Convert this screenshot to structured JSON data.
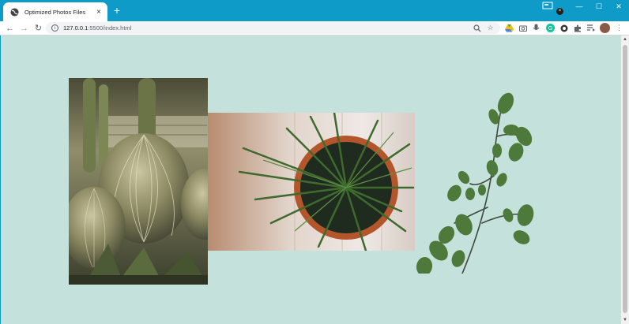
{
  "browser": {
    "tab_title": "Optimized Photos Files",
    "url_host": "127.0.0.1",
    "url_path": ":5500/index.html",
    "new_tab_label": "+",
    "tab_close_label": "×",
    "ext_dot_label": "×"
  },
  "window_controls": {
    "minimize": "—",
    "maximize": "☐",
    "close": "✕"
  },
  "toolbar_icons": [
    "zoom-icon",
    "star-icon",
    "drive-icon",
    "camera-icon",
    "mic-icon",
    "grammarly-icon",
    "circle-ext-icon",
    "puzzle-icon",
    "reading-list-icon",
    "avatar",
    "kebab-menu-icon"
  ],
  "photos": [
    {
      "name": "cactus-photo",
      "subject": "barrel cacti"
    },
    {
      "name": "palm-photo",
      "subject": "potted palm from above"
    },
    {
      "name": "branch-photo",
      "subject": "leafy branch"
    }
  ],
  "colors": {
    "page_bg": "#c5e1dc",
    "titlebar": "#0f9bc8"
  }
}
